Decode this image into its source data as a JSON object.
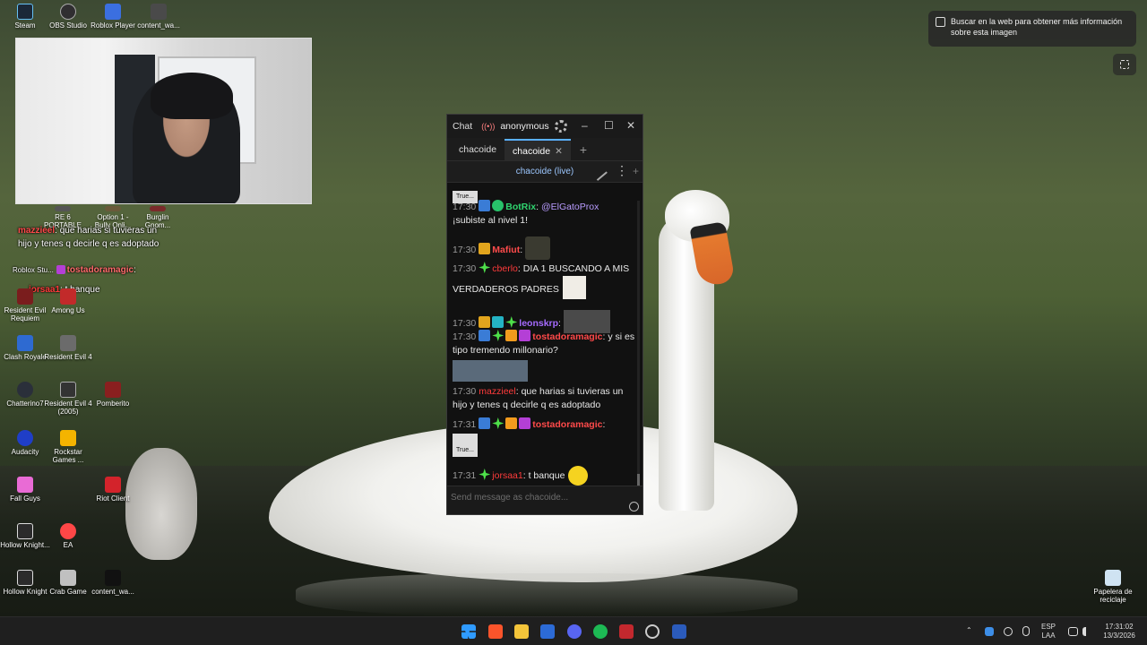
{
  "desktop": {
    "icons_top": [
      {
        "label": "Steam",
        "color": "#1b2838"
      },
      {
        "label": "OBS Studio",
        "color": "#302e31"
      },
      {
        "label": "Roblox Player",
        "color": "#3b6fe0"
      },
      {
        "label": "content_wa...",
        "color": "#4a4a4a"
      }
    ],
    "icons_left": [
      {
        "label": "Resident Evil Requiem",
        "color": "#7a1d1d"
      },
      {
        "label": "Among Us",
        "color": "#c22a2a"
      },
      {
        "label": "Clash Royale",
        "color": "#2e6ad1"
      },
      {
        "label": "Resident Evil 4",
        "color": "#6b6b6b"
      },
      {
        "label": "Chatterino7",
        "color": "#2a2f3a"
      },
      {
        "label": "Resident Evil 4 (2005)",
        "color": "#333333"
      },
      {
        "label": "Pomberito",
        "color": "#8a1f1f"
      },
      {
        "label": "Audacity",
        "color": "#1f3ec7"
      },
      {
        "label": "Rockstar Games ...",
        "color": "#f4b400"
      },
      {
        "label": "Fall Guys",
        "color": "#e96bd5"
      },
      {
        "label": "Riot Client",
        "color": "#d3232b"
      },
      {
        "label": "Hollow Knight...",
        "color": "#2b2b2b"
      },
      {
        "label": "EA",
        "color": "#ff4747"
      },
      {
        "label": "Hollow Knight",
        "color": "#2b2b2b"
      },
      {
        "label": "Crab Game",
        "color": "#c0c0c0"
      },
      {
        "label": "content_wa...",
        "color": "#111111"
      }
    ],
    "partial_labels": [
      "RE 6 PORTABLE",
      "Option 1 - Bully Onli...",
      "Burglin Gnom...",
      "Roblox Stu..."
    ],
    "recycle_bin": "Papelera de reciclaje"
  },
  "overlay_chat": [
    {
      "user": "mazzieel",
      "text": ": que harias si tuvieras un hijo y tenes q decirle q es adoptado"
    },
    {
      "user": "tostadoramagic",
      "text": ":"
    },
    {
      "user": "jorsaa1",
      "text": ": t banque"
    }
  ],
  "lens": {
    "tooltip": "Buscar en la web para obtener más información sobre esta imagen"
  },
  "chat_window": {
    "title": "Chat",
    "status": "anonymous",
    "tabs": [
      "chacoide",
      "chacoide"
    ],
    "channel_header": "chacoide (live)",
    "input_placeholder": "Send message as chacoide...",
    "messages": [
      {
        "time": "17:30",
        "user": "BotRix",
        "user_color": "#2fd46f",
        "text": " @ElGatoProx ¡subiste al nivel 1!",
        "mention": "@ElGatoProx",
        "body": "¡subiste al nivel 1!"
      },
      {
        "time": "17:30",
        "user": "Mafiut",
        "user_color": "#ff4b4b",
        "text": ""
      },
      {
        "time": "17:30",
        "user": "cberlo",
        "user_color": "#ff3b3b",
        "text": "DIA 1 BUSCANDO A MIS VERDADEROS PADRES"
      },
      {
        "time": "17:30",
        "user": "leonskrp",
        "user_color": "#a56bff",
        "text": ""
      },
      {
        "time": "17:30",
        "user": "tostadoramagic",
        "user_color": "#ff4a4a",
        "text": "y si es tipo tremendo millonario?"
      },
      {
        "time": "17:30",
        "user": "mazzieel",
        "user_color": "#ff3b3b",
        "text": "que harias si tuvieras un hijo y tenes q decirle q es adoptado"
      },
      {
        "time": "17:31",
        "user": "tostadoramagic",
        "user_color": "#ff4a4a",
        "text": ""
      },
      {
        "time": "17:31",
        "user": "jorsaa1",
        "user_color": "#ff3b3b",
        "text": "t banque"
      }
    ],
    "emote_labels": [
      "True..."
    ]
  },
  "taskbar": {
    "lang_1": "ESP",
    "lang_2": "LAA",
    "time": "17:31:02",
    "date": "13/3/2026"
  }
}
